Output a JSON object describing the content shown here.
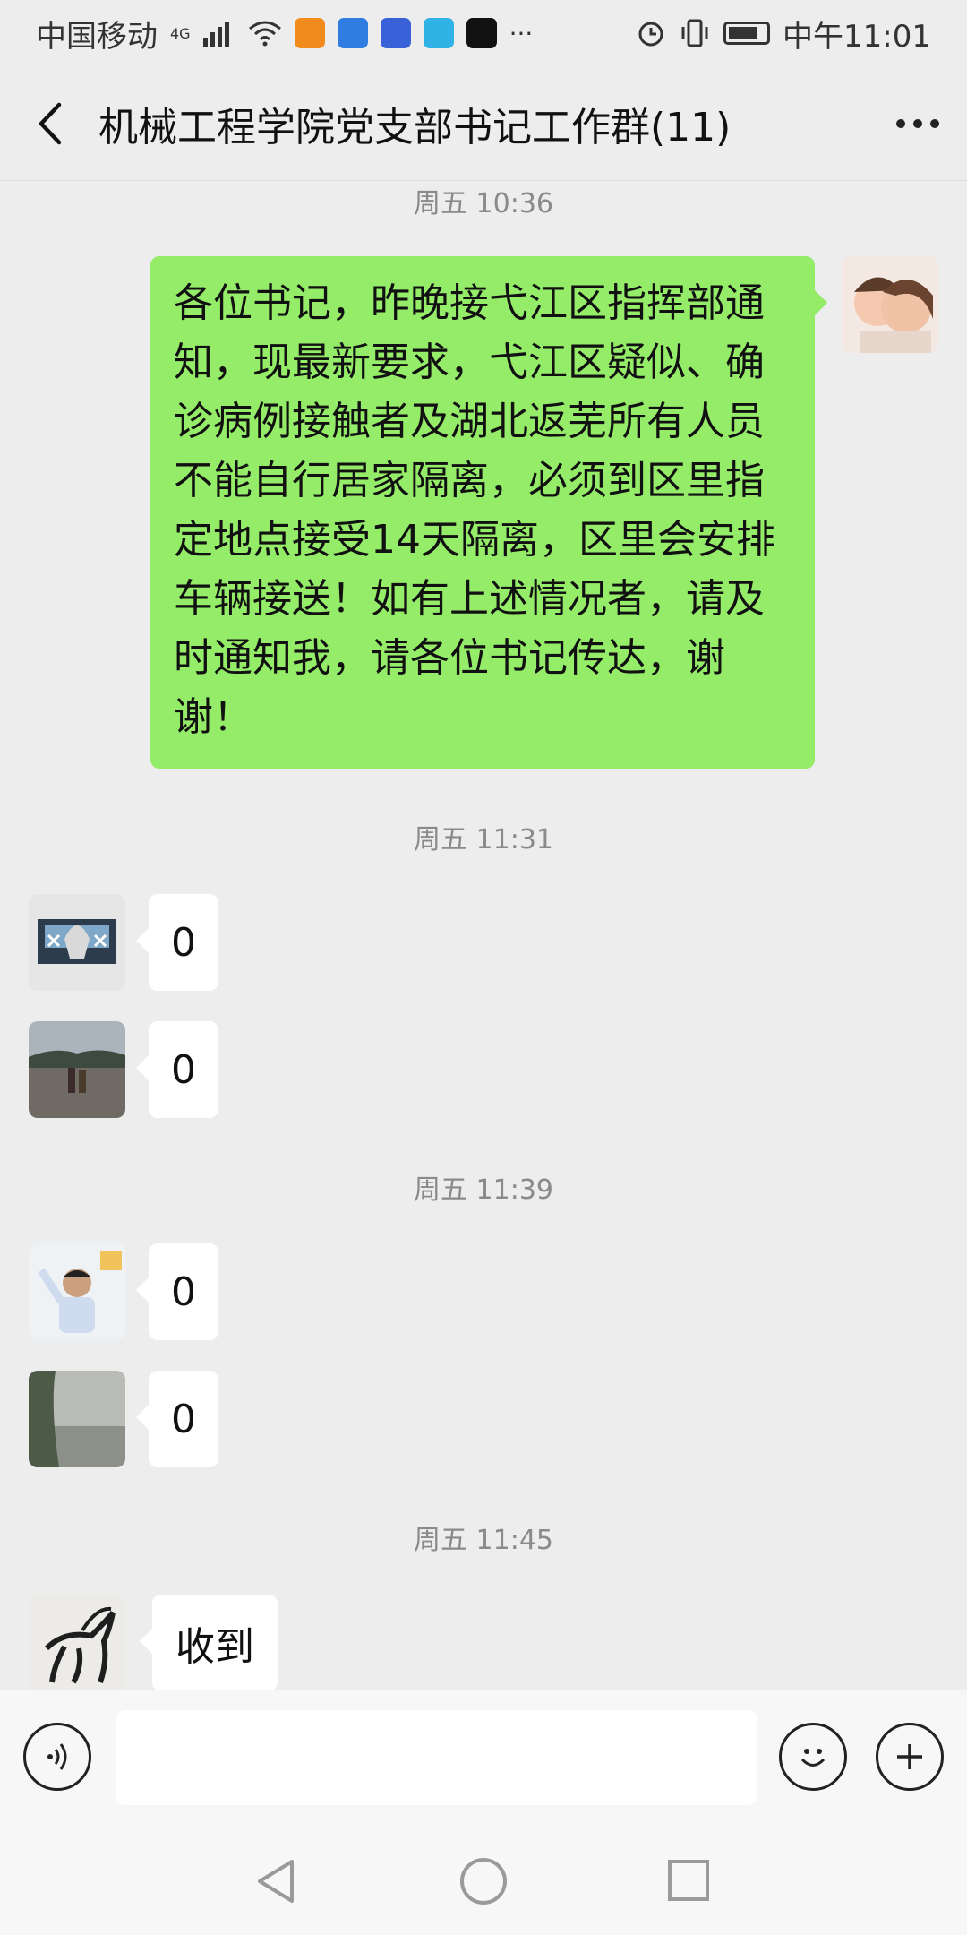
{
  "status_bar": {
    "carrier": "中国移动",
    "network": "4G",
    "time": "中午11:01"
  },
  "header": {
    "title": "机械工程学院党支部书记工作群(11)"
  },
  "messages": {
    "t1": "周五 10:36",
    "m1": "各位书记，昨晚接弋江区指挥部通知，现最新要求，弋江区疑似、确诊病例接触者及湖北返芜所有人员不能自行居家隔离，必须到区里指定地点接受14天隔离，区里会安排车辆接送！如有上述情况者，请及时通知我，请各位书记传达，谢谢！",
    "t2": "周五 11:31",
    "m2": "0",
    "m3": "0",
    "t3": "周五 11:39",
    "m4": "0",
    "m5": "0",
    "t4": "周五 11:45",
    "m6": "收到"
  },
  "input": {
    "value": ""
  },
  "colors": {
    "sent_bubble": "#95ec69",
    "background": "#ededed"
  },
  "icons": [
    "back-icon",
    "more-icon",
    "voice-icon",
    "emoji-icon",
    "plus-icon",
    "nav-back-icon",
    "nav-home-icon",
    "nav-recent-icon"
  ]
}
